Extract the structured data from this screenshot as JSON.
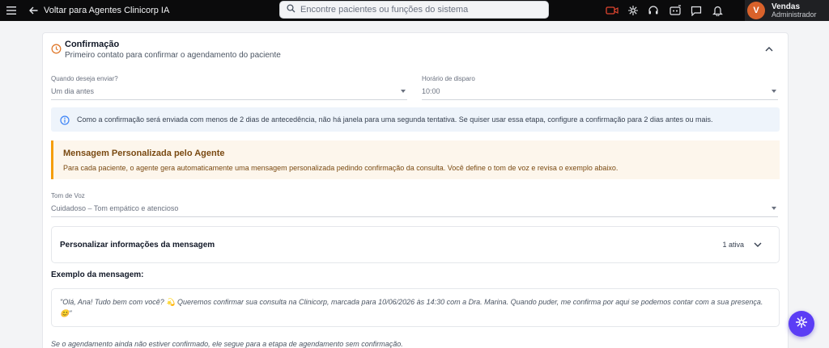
{
  "topbar": {
    "back_label": "Voltar para Agentes Clinicorp IA",
    "search_placeholder": "Encontre pacientes ou funções do sistema",
    "user_initial": "V",
    "user_name": "Vendas",
    "user_role": "Administrador",
    "video_icon_color": "#e0452f"
  },
  "section": {
    "title": "Confirmação",
    "subtitle": "Primeiro contato para confirmar o agendamento do paciente",
    "icon_color": "#e07a2e"
  },
  "fields": {
    "send_when_label": "Quando deseja enviar?",
    "send_when_value": "Um dia antes",
    "time_label": "Horário de disparo",
    "time_value": "10:00",
    "tone_label": "Tom de Voz",
    "tone_value": "Cuidadoso – Tom empático e atencioso"
  },
  "info_message": "Como a confirmação será enviada com menos de 2 dias de antecedência, não há janela para uma segunda tentativa. Se quiser usar essa etapa, configure a confirmação para 2 dias antes ou mais.",
  "agent_box": {
    "title": "Mensagem Personalizada pelo Agente",
    "text": "Para cada paciente, o agente gera automaticamente uma mensagem personalizada pedindo confirmação da consulta. Você define o tom de voz e revisa o exemplo abaixo."
  },
  "customize": {
    "title": "Personalizar informações da mensagem",
    "badge": "1 ativa"
  },
  "example": {
    "title": "Exemplo da mensagem:",
    "text": "\"Olá, Ana! Tudo bem com você? 💫 Queremos confirmar sua consulta na Clinicorp, marcada para 10/06/2026 às 14:30 com a Dra. Marina. Quando puder, me confirma por aqui se podemos contar com a sua presença. 😊\""
  },
  "footer_note": "Se o agendamento ainda não estiver confirmado, ele segue para a etapa de agendamento sem confirmação."
}
